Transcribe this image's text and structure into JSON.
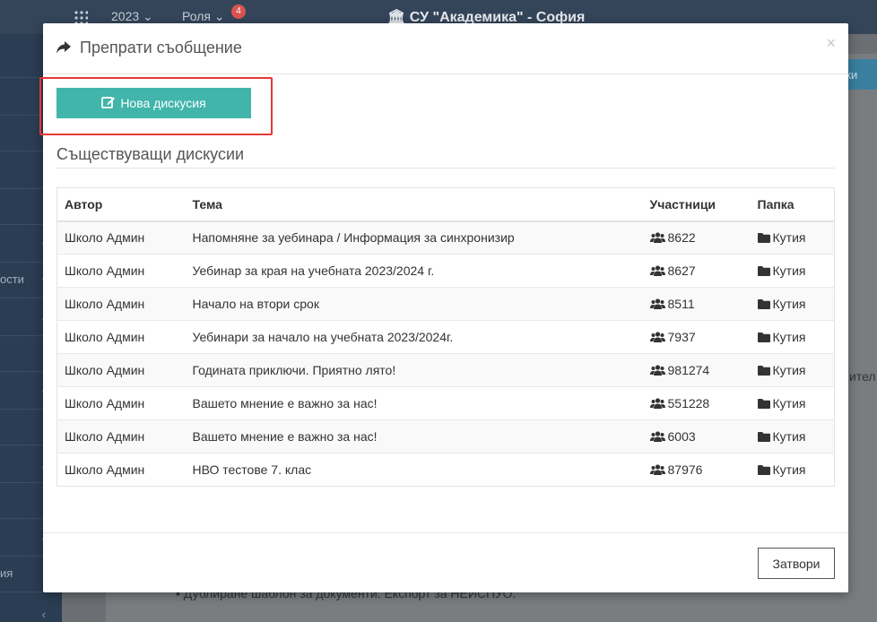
{
  "background": {
    "year": "2023",
    "role": "Роля",
    "notifications": "4",
    "school": "СУ \"Академика\" - София",
    "sidebar_fragment_1": "ости",
    "sidebar_fragment_2": "ия",
    "right_button_fragment": "йки",
    "right_text_fragment": "ител",
    "bottom_text_fragment": "Дублиране шаблон за документи. Експорт за НЕИСПУО."
  },
  "modal": {
    "title": "Препрати съобщение",
    "close_symbol": "×",
    "new_discussion_label": "Нова дискусия",
    "section_title": "Съществуващи дискусии",
    "columns": {
      "author": "Автор",
      "topic": "Тема",
      "participants": "Участници",
      "folder": "Папка"
    },
    "rows": [
      {
        "author": "Школо Админ",
        "topic": "Напомняне за уебинара / Информация за синхронизир",
        "participants": "8622",
        "folder": "Кутия"
      },
      {
        "author": "Школо Админ",
        "topic": "Уебинар за края на учебната 2023/2024 г.",
        "participants": "8627",
        "folder": "Кутия"
      },
      {
        "author": "Школо Админ",
        "topic": "Начало на втори срок",
        "participants": "8511",
        "folder": "Кутия"
      },
      {
        "author": "Школо Админ",
        "topic": "Уебинари за начало на учебната 2023/2024г.",
        "participants": "7937",
        "folder": "Кутия"
      },
      {
        "author": "Школо Админ",
        "topic": "Годината приключи. Приятно лято!",
        "participants": "981274",
        "folder": "Кутия"
      },
      {
        "author": "Школо Админ",
        "topic": "Вашето мнение е важно за нас!",
        "participants": "551228",
        "folder": "Кутия"
      },
      {
        "author": "Школо Админ",
        "topic": "Вашето мнение е важно за нас!",
        "participants": "6003",
        "folder": "Кутия"
      },
      {
        "author": "Школо Админ",
        "topic": "НВО тестове 7. клас",
        "participants": "87976",
        "folder": "Кутия"
      }
    ],
    "close_button_label": "Затвори"
  },
  "icons": {
    "title": "share-arrow-icon",
    "new": "edit-icon",
    "participants": "users-icon",
    "folder": "folder-icon"
  },
  "colors": {
    "primary_button": "#41b5ab",
    "highlight": "#e53935",
    "sidebar": "#2b3d52",
    "topbar": "#34455a"
  }
}
